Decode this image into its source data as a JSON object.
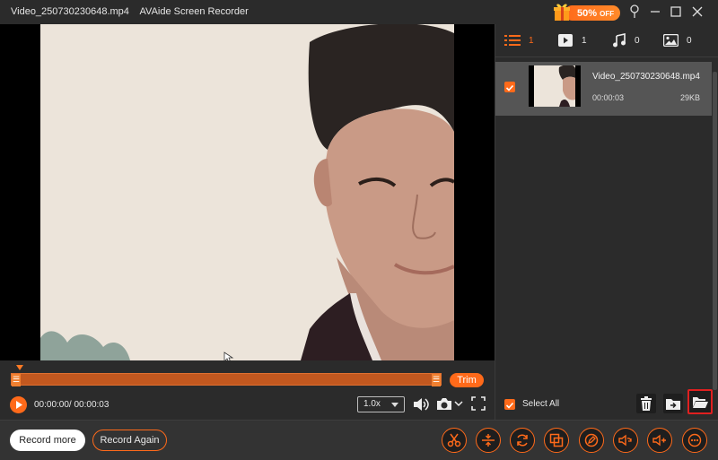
{
  "window": {
    "title": "Video_250730230648.mp4    AVAide Screen Recorder"
  },
  "promo": {
    "percent": "50%",
    "suffix": "OFF"
  },
  "timeline": {
    "trim_label": "Trim",
    "time": "00:00:00/ 00:00:03",
    "speed": "1.0x",
    "handle_glyph": "☰"
  },
  "sidebar": {
    "tabs": [
      {
        "icon": "list-icon",
        "count": "1"
      },
      {
        "icon": "video-icon",
        "count": "1"
      },
      {
        "icon": "audio-icon",
        "count": "0"
      },
      {
        "icon": "image-icon",
        "count": "0"
      }
    ],
    "file": {
      "name": "Video_250730230648.mp4",
      "duration": "00:00:03",
      "size": "29KB"
    },
    "select_all": "Select All"
  },
  "footer": {
    "record_more": "Record more",
    "record_again": "Record Again"
  },
  "colors": {
    "accent": "#ff6a1a",
    "bg": "#2b2b2b",
    "highlight": "#e02020"
  }
}
